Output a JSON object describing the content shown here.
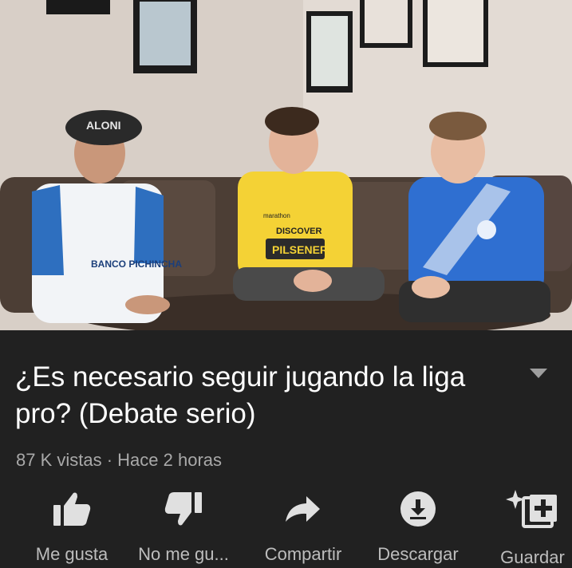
{
  "video": {
    "shirts": {
      "left_sponsor": "BANCO PICHINCHA",
      "left_cap": "ALONI",
      "middle_sponsor_1": "DISCOVER",
      "middle_sponsor_2": "PILSENER",
      "middle_sponsor_3": "marathon"
    }
  },
  "title": "¿Es necesario seguir jugando la liga pro? (Debate serio)",
  "meta": {
    "views": "87 K vistas",
    "separator": " · ",
    "time": "Hace 2 horas"
  },
  "actions": [
    {
      "label": "Me gusta",
      "icon": "thumbs-up-icon"
    },
    {
      "label": "No me gu...",
      "icon": "thumbs-down-icon"
    },
    {
      "label": "Compartir",
      "icon": "share-icon"
    },
    {
      "label": "Descargar",
      "icon": "download-icon"
    },
    {
      "label": "Guardar",
      "icon": "save-playlist-icon"
    }
  ],
  "colors": {
    "background": "#212121",
    "meta_text": "#a9a9a9",
    "icon": "#e0e0e0"
  }
}
